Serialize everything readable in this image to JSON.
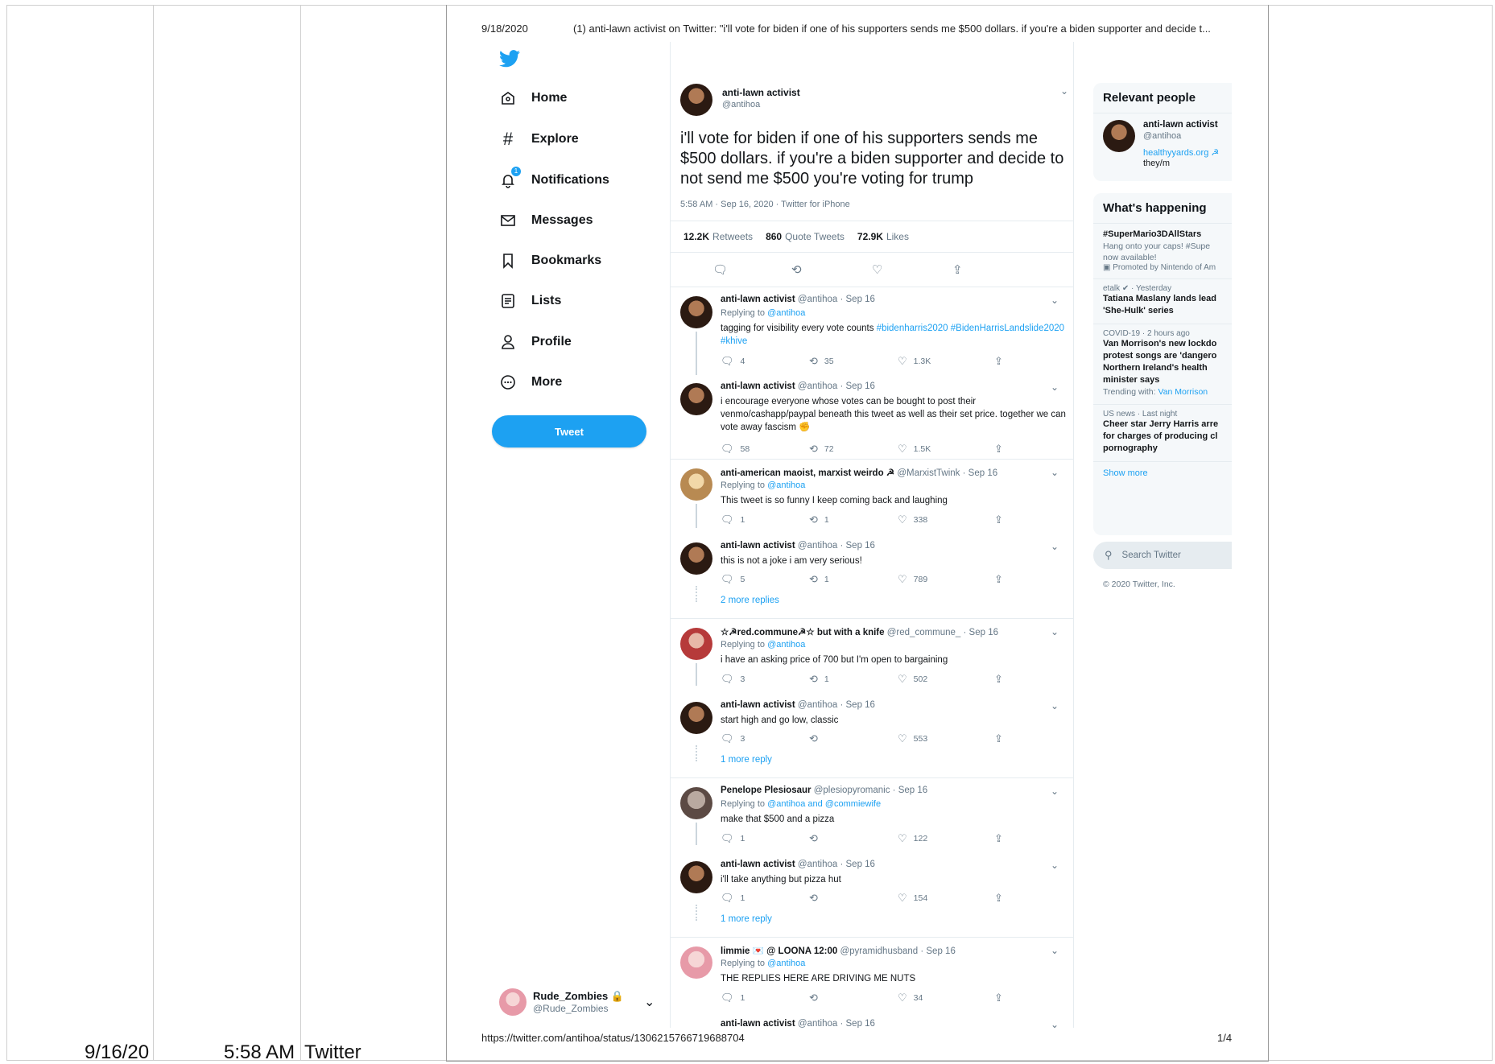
{
  "exhibit": {
    "date": "9/16/20",
    "time": "5:58 AM",
    "source": "Twitter"
  },
  "print": {
    "date": "9/18/2020",
    "title": "(1) anti-lawn activist on Twitter: \"i'll vote for biden if one of his supporters sends me $500 dollars. if you're a biden supporter and decide t...",
    "url": "https://twitter.com/antihoa/status/1306215766719688704",
    "page": "1/4"
  },
  "nav": {
    "items": [
      {
        "label": "Home",
        "icon": "home-icon"
      },
      {
        "label": "Explore",
        "icon": "hashtag-icon"
      },
      {
        "label": "Notifications",
        "icon": "bell-icon"
      },
      {
        "label": "Messages",
        "icon": "envelope-icon"
      },
      {
        "label": "Bookmarks",
        "icon": "bookmark-icon"
      },
      {
        "label": "Lists",
        "icon": "list-icon"
      },
      {
        "label": "Profile",
        "icon": "person-icon"
      },
      {
        "label": "More",
        "icon": "more-icon"
      }
    ],
    "tweet_button": "Tweet",
    "notification_badge": "1",
    "account": {
      "name": "Rude_Zombies",
      "handle": "@Rude_Zombies"
    }
  },
  "focus_tweet": {
    "name": "anti-lawn activist",
    "handle": "@antihoa",
    "text": "i'll vote for biden if one of his supporters sends me $500 dollars. if you're a biden supporter and decide to not send me $500 you're voting for trump",
    "meta": "5:58 AM · Sep 16, 2020 · Twitter for iPhone",
    "retweets": "12.2K",
    "retweets_label": "Retweets",
    "quotes": "860",
    "quotes_label": "Quote Tweets",
    "likes": "72.9K",
    "likes_label": "Likes"
  },
  "replies": [
    {
      "name": "anti-lawn activist",
      "meta": "@antihoa · Sep 16",
      "replying": "Replying to",
      "replying_to": "@antihoa",
      "text": "tagging for visibility every vote counts",
      "text_link": "#bidenharris2020 #BidenHarrisLandslide2020 #khive",
      "replies": "4",
      "retweets": "35",
      "likes": "1.3K"
    },
    {
      "name": "anti-lawn activist",
      "meta": "@antihoa · Sep 16",
      "text": "i encourage everyone whose votes can be bought to post their venmo/cashapp/paypal beneath this tweet as well as their set price. together we can vote away fascism",
      "emoji": "✊",
      "replies": "58",
      "retweets": "72",
      "likes": "1.5K"
    },
    {
      "name": "anti-american maoist, marxist weirdo ☭",
      "meta": "@MarxistTwink · Sep 16",
      "replying": "Replying to",
      "replying_to": "@antihoa",
      "text": "This tweet is so funny I keep coming back and laughing",
      "replies": "1",
      "retweets": "1",
      "likes": "338"
    },
    {
      "name": "anti-lawn activist",
      "meta": "@antihoa · Sep 16",
      "text": "this is not a joke i am very serious!",
      "replies": "5",
      "retweets": "1",
      "likes": "789",
      "more": "2 more replies"
    },
    {
      "name": "☆☭red.commune☭☆ but with a knife",
      "meta": "@red_commune_ · Sep 16",
      "replying": "Replying to",
      "replying_to": "@antihoa",
      "text": "i have an asking price of 700 but I'm open to bargaining",
      "replies": "3",
      "retweets": "1",
      "likes": "502"
    },
    {
      "name": "anti-lawn activist",
      "meta": "@antihoa · Sep 16",
      "text": "start high and go low, classic",
      "replies": "3",
      "retweets": "",
      "likes": "553",
      "more": "1 more reply"
    },
    {
      "name": "Penelope Plesiosaur",
      "meta": "@plesiopyromanic · Sep 16",
      "replying": "Replying to",
      "replying_to": "@antihoa and @commiewife",
      "text": "make that $500 and a pizza",
      "replies": "1",
      "retweets": "",
      "likes": "122"
    },
    {
      "name": "anti-lawn activist",
      "meta": "@antihoa · Sep 16",
      "text": "i'll take anything but pizza hut",
      "replies": "1",
      "retweets": "",
      "likes": "154",
      "more": "1 more reply"
    },
    {
      "name": "limmie 💌 @ LOONA 12:00",
      "meta": "@pyramidhusband · Sep 16",
      "replying": "Replying to",
      "replying_to": "@antihoa",
      "text": "THE REPLIES HERE ARE DRIVING ME NUTS",
      "replies": "1",
      "retweets": "",
      "likes": "34"
    }
  ],
  "partial_reply": {
    "name": "anti-lawn activist",
    "meta": "@antihoa · Sep 16"
  },
  "sidebar": {
    "relevant_title": "Relevant people",
    "person": {
      "name": "anti-lawn activist",
      "handle": "@antihoa",
      "link": "healthyyards.org ☭",
      "pronouns": "they/m"
    },
    "happening_title": "What's happening",
    "trends": [
      {
        "ctx": "",
        "title": "#SuperMario3DAllStars",
        "sub1": "Hang onto your caps! #Supe",
        "sub2": "now available!",
        "sub3": "Promoted by Nintendo of Am"
      },
      {
        "ctx": "etalk ✔ · Yesterday",
        "title": "Tatiana Maslany lands lead",
        "title2": "'She-Hulk' series"
      },
      {
        "ctx": "COVID-19 · 2 hours ago",
        "title": "Van Morrison's new lockdo",
        "title2": "protest songs are 'dangero",
        "title3": "Northern Ireland's health",
        "title4": "minister says",
        "sub1": "Trending with:",
        "sub1_link": "Van Morrison"
      },
      {
        "ctx": "US news · Last night",
        "title": "Cheer star Jerry Harris arre",
        "title2": "for charges of producing cl",
        "title3": "pornography"
      }
    ],
    "show_more": "Show more",
    "search_placeholder": "Search Twitter",
    "copyright": "© 2020 Twitter, Inc."
  }
}
